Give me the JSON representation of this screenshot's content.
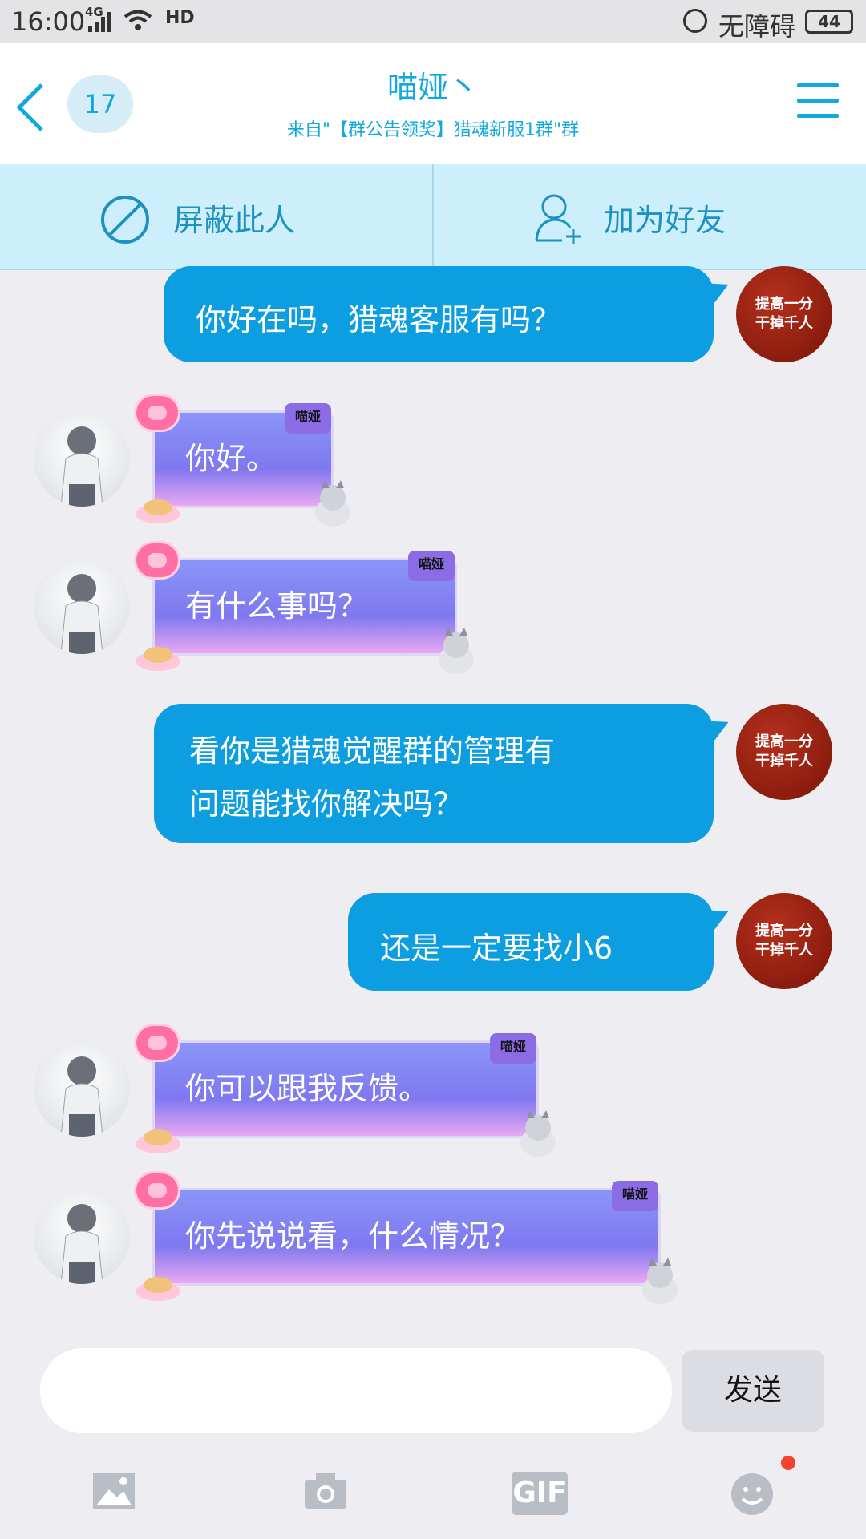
{
  "status_bar": {
    "time": "16:00",
    "network": "4G",
    "accessibility": "无障碍",
    "battery": "44"
  },
  "header": {
    "back_icon": "chevron-left-icon",
    "unread_count": "17",
    "title": "喵娅丶",
    "subtitle": "来自\"【群公告领奖】猎魂新服1群\"群",
    "menu_icon": "hamburger-menu-icon"
  },
  "actions": {
    "block_label": "屏蔽此人",
    "add_friend_label": "加为好友"
  },
  "my_avatar_text": [
    "提高一分",
    "干掉千人"
  ],
  "bubble_tag": "喵娅",
  "messages": [
    {
      "side": "right",
      "text": "你好在吗，猎魂客服有吗？"
    },
    {
      "side": "left",
      "text": "你好。"
    },
    {
      "side": "left",
      "text": "有什么事吗？"
    },
    {
      "side": "right",
      "lines": [
        "看你是猎魂觉醒群的管理有",
        "问题能找你解决吗？"
      ]
    },
    {
      "side": "right",
      "text": "还是一定要找小6"
    },
    {
      "side": "left",
      "text": "你可以跟我反馈。"
    },
    {
      "side": "left",
      "text": "你先说说看，什么情况？"
    }
  ],
  "input": {
    "placeholder": "",
    "send_label": "发送"
  },
  "toolbar": [
    "image-icon",
    "camera-icon",
    "gif-icon",
    "emoji-icon"
  ],
  "toolbar_gif_label": "GIF",
  "colors": {
    "accent": "#12a8dc",
    "my_bubble": "#0c9ee0",
    "notification_dot": "#f5442e"
  }
}
